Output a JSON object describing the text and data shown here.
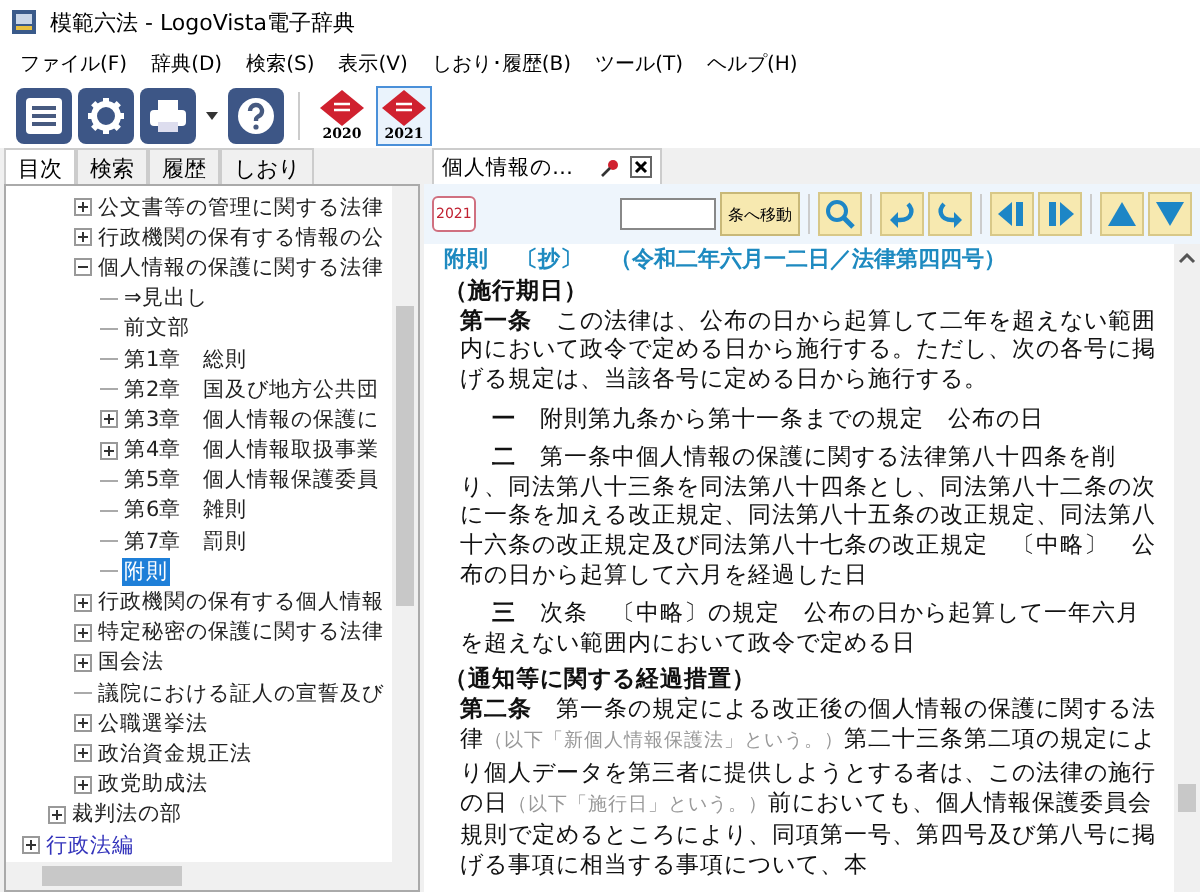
{
  "window": {
    "title": "模範六法 - LogoVista電子辞典"
  },
  "menu": [
    "ファイル(F)",
    "辞典(D)",
    "検索(S)",
    "表示(V)",
    "しおり･履歴(B)",
    "ツール(T)",
    "ヘルプ(H)"
  ],
  "toolbar": [
    {
      "kind": "list"
    },
    {
      "kind": "gear"
    },
    {
      "kind": "printer"
    },
    {
      "kind": "help"
    },
    {
      "kind": "book",
      "year": "2020",
      "selected": false
    },
    {
      "kind": "book",
      "year": "2021",
      "selected": true
    }
  ],
  "side_tabs": [
    {
      "label": "目次",
      "selected": true
    },
    {
      "label": "検索",
      "selected": false
    },
    {
      "label": "履歴",
      "selected": false
    },
    {
      "label": "しおり",
      "selected": false
    }
  ],
  "tree": [
    {
      "children": [
        {
          "children": [
            {
              "label": "公文書等の管理に関する法律",
              "expanded": false,
              "selected": false
            },
            {
              "label": "行政機関の保有する情報の公",
              "expanded": false,
              "selected": false
            },
            {
              "label": "個人情報の保護に関する法律",
              "expanded": true,
              "selected": false,
              "children": [
                {
                  "label": "⇒見出し",
                  "selected": false
                },
                {
                  "label": "前文部",
                  "selected": false
                },
                {
                  "label": "第1章　総則",
                  "selected": false
                },
                {
                  "label": "第2章　国及び地方公共団",
                  "selected": false
                },
                {
                  "label": "第3章　個人情報の保護に",
                  "expanded": false,
                  "selected": false
                },
                {
                  "label": "第4章　個人情報取扱事業",
                  "expanded": false,
                  "selected": false
                },
                {
                  "label": "第5章　個人情報保護委員",
                  "selected": false
                },
                {
                  "label": "第6章　雑則",
                  "selected": false
                },
                {
                  "label": "第7章　罰則",
                  "selected": false
                },
                {
                  "label": "附則",
                  "selected": true
                }
              ]
            },
            {
              "label": "行政機関の保有する個人情報",
              "expanded": false,
              "selected": false
            },
            {
              "label": "特定秘密の保護に関する法律",
              "expanded": false,
              "selected": false
            },
            {
              "label": "国会法",
              "expanded": false,
              "selected": false
            },
            {
              "label": "議院における証人の宣誓及び",
              "selected": false
            },
            {
              "label": "公職選挙法",
              "expanded": false,
              "selected": false
            },
            {
              "label": "政治資金規正法",
              "expanded": false,
              "selected": false
            },
            {
              "label": "政党助成法",
              "expanded": false,
              "selected": false
            }
          ]
        },
        {
          "label": "裁判法の部",
          "expanded": false,
          "selected": false
        }
      ]
    },
    {
      "label": "行政法編",
      "expanded": false,
      "selected": false
    }
  ],
  "doc_tab": {
    "label": "個人情報の…"
  },
  "doc_toolbar": {
    "year": "2021",
    "jump_button": "条へ移動"
  },
  "document": {
    "heading": [
      "附則",
      "〔抄〕",
      "（令和二年六月一二日／法律第四四号）"
    ],
    "blocks": [
      {
        "kind": "caption",
        "text": "（施行期日）"
      },
      {
        "kind": "article",
        "segments": [
          {
            "text": "**第一条**　この法律は、公布の日から起算して二年を超えない範囲内において政令で定める日から施行する。ただし、次の各号に掲げる規定は、当該各号に定める日から施行する。",
            "note": false
          }
        ]
      },
      {
        "kind": "item",
        "segments": [
          {
            "text": "**一**　附則第九条から第十一条までの規定　公布の日",
            "note": false
          }
        ]
      },
      {
        "kind": "item",
        "segments": [
          {
            "text": "**二**　第一条中個人情報の保護に関する法律第八十四条を削り、同法第八十三条を同法第八十四条とし、同法第八十二条の次に一条を加える改正規定、同法第八十五条の改正規定、同法第八十六条の改正規定及び同法第八十七条の改正規定　〔中略〕　公布の日から起算して六月を経過した日",
            "note": false
          }
        ]
      },
      {
        "kind": "item",
        "segments": [
          {
            "text": "**三**　次条　〔中略〕の規定　公布の日から起算して一年六月を超えない範囲内において政令で定める日",
            "note": false
          }
        ]
      },
      {
        "kind": "caption",
        "text": "（通知等に関する経過措置）"
      },
      {
        "kind": "article",
        "segments": [
          {
            "text": "**第二条**　第一条の規定による改正後の個人情報の保護に関する法律",
            "note": false
          },
          {
            "text": "（以下「新個人情報保護法」という。）",
            "note": true
          },
          {
            "text": "第二十三条第二項の規定により個人データを第三者に提供しようとする者は、この法律の施行の日",
            "note": false
          },
          {
            "text": "（以下「施行日」という。）",
            "note": true
          },
          {
            "text": "前においても、個人情報保護委員会規則で定めるところにより、同項第一号、第四号及び第八号に掲げる事項に相当する事項について、本",
            "note": false
          }
        ]
      }
    ]
  }
}
